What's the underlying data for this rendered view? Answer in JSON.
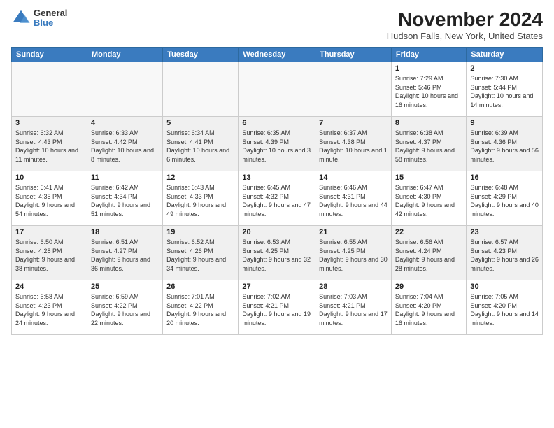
{
  "logo": {
    "general": "General",
    "blue": "Blue"
  },
  "title": "November 2024",
  "location": "Hudson Falls, New York, United States",
  "days_header": [
    "Sunday",
    "Monday",
    "Tuesday",
    "Wednesday",
    "Thursday",
    "Friday",
    "Saturday"
  ],
  "weeks": [
    [
      {
        "day": "",
        "info": ""
      },
      {
        "day": "",
        "info": ""
      },
      {
        "day": "",
        "info": ""
      },
      {
        "day": "",
        "info": ""
      },
      {
        "day": "",
        "info": ""
      },
      {
        "day": "1",
        "info": "Sunrise: 7:29 AM\nSunset: 5:46 PM\nDaylight: 10 hours and 16 minutes."
      },
      {
        "day": "2",
        "info": "Sunrise: 7:30 AM\nSunset: 5:44 PM\nDaylight: 10 hours and 14 minutes."
      }
    ],
    [
      {
        "day": "3",
        "info": "Sunrise: 6:32 AM\nSunset: 4:43 PM\nDaylight: 10 hours and 11 minutes."
      },
      {
        "day": "4",
        "info": "Sunrise: 6:33 AM\nSunset: 4:42 PM\nDaylight: 10 hours and 8 minutes."
      },
      {
        "day": "5",
        "info": "Sunrise: 6:34 AM\nSunset: 4:41 PM\nDaylight: 10 hours and 6 minutes."
      },
      {
        "day": "6",
        "info": "Sunrise: 6:35 AM\nSunset: 4:39 PM\nDaylight: 10 hours and 3 minutes."
      },
      {
        "day": "7",
        "info": "Sunrise: 6:37 AM\nSunset: 4:38 PM\nDaylight: 10 hours and 1 minute."
      },
      {
        "day": "8",
        "info": "Sunrise: 6:38 AM\nSunset: 4:37 PM\nDaylight: 9 hours and 58 minutes."
      },
      {
        "day": "9",
        "info": "Sunrise: 6:39 AM\nSunset: 4:36 PM\nDaylight: 9 hours and 56 minutes."
      }
    ],
    [
      {
        "day": "10",
        "info": "Sunrise: 6:41 AM\nSunset: 4:35 PM\nDaylight: 9 hours and 54 minutes."
      },
      {
        "day": "11",
        "info": "Sunrise: 6:42 AM\nSunset: 4:34 PM\nDaylight: 9 hours and 51 minutes."
      },
      {
        "day": "12",
        "info": "Sunrise: 6:43 AM\nSunset: 4:33 PM\nDaylight: 9 hours and 49 minutes."
      },
      {
        "day": "13",
        "info": "Sunrise: 6:45 AM\nSunset: 4:32 PM\nDaylight: 9 hours and 47 minutes."
      },
      {
        "day": "14",
        "info": "Sunrise: 6:46 AM\nSunset: 4:31 PM\nDaylight: 9 hours and 44 minutes."
      },
      {
        "day": "15",
        "info": "Sunrise: 6:47 AM\nSunset: 4:30 PM\nDaylight: 9 hours and 42 minutes."
      },
      {
        "day": "16",
        "info": "Sunrise: 6:48 AM\nSunset: 4:29 PM\nDaylight: 9 hours and 40 minutes."
      }
    ],
    [
      {
        "day": "17",
        "info": "Sunrise: 6:50 AM\nSunset: 4:28 PM\nDaylight: 9 hours and 38 minutes."
      },
      {
        "day": "18",
        "info": "Sunrise: 6:51 AM\nSunset: 4:27 PM\nDaylight: 9 hours and 36 minutes."
      },
      {
        "day": "19",
        "info": "Sunrise: 6:52 AM\nSunset: 4:26 PM\nDaylight: 9 hours and 34 minutes."
      },
      {
        "day": "20",
        "info": "Sunrise: 6:53 AM\nSunset: 4:25 PM\nDaylight: 9 hours and 32 minutes."
      },
      {
        "day": "21",
        "info": "Sunrise: 6:55 AM\nSunset: 4:25 PM\nDaylight: 9 hours and 30 minutes."
      },
      {
        "day": "22",
        "info": "Sunrise: 6:56 AM\nSunset: 4:24 PM\nDaylight: 9 hours and 28 minutes."
      },
      {
        "day": "23",
        "info": "Sunrise: 6:57 AM\nSunset: 4:23 PM\nDaylight: 9 hours and 26 minutes."
      }
    ],
    [
      {
        "day": "24",
        "info": "Sunrise: 6:58 AM\nSunset: 4:23 PM\nDaylight: 9 hours and 24 minutes."
      },
      {
        "day": "25",
        "info": "Sunrise: 6:59 AM\nSunset: 4:22 PM\nDaylight: 9 hours and 22 minutes."
      },
      {
        "day": "26",
        "info": "Sunrise: 7:01 AM\nSunset: 4:22 PM\nDaylight: 9 hours and 20 minutes."
      },
      {
        "day": "27",
        "info": "Sunrise: 7:02 AM\nSunset: 4:21 PM\nDaylight: 9 hours and 19 minutes."
      },
      {
        "day": "28",
        "info": "Sunrise: 7:03 AM\nSunset: 4:21 PM\nDaylight: 9 hours and 17 minutes."
      },
      {
        "day": "29",
        "info": "Sunrise: 7:04 AM\nSunset: 4:20 PM\nDaylight: 9 hours and 16 minutes."
      },
      {
        "day": "30",
        "info": "Sunrise: 7:05 AM\nSunset: 4:20 PM\nDaylight: 9 hours and 14 minutes."
      }
    ]
  ]
}
